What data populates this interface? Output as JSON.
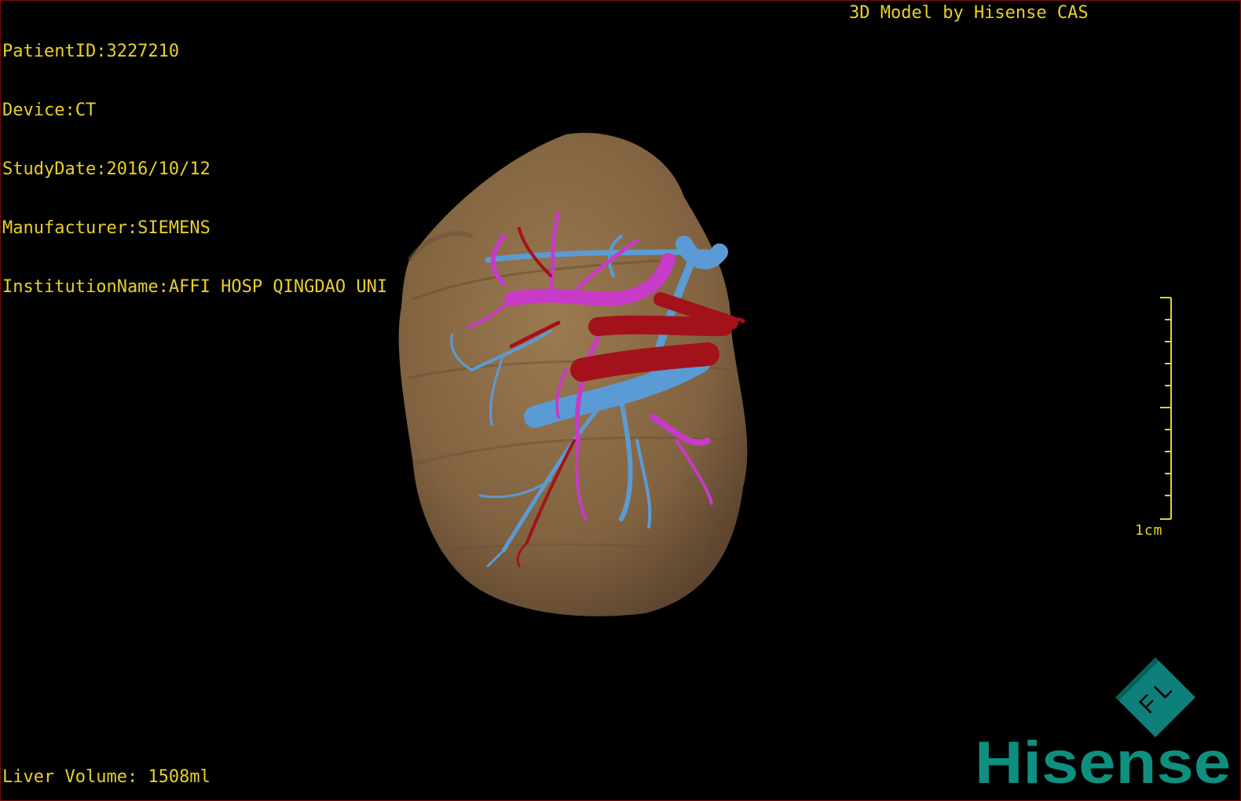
{
  "info": {
    "patient_id": "PatientID:3227210",
    "device": "Device:CT",
    "study_date": "StudyDate:2016/10/12",
    "manufacturer": "Manufacturer:SIEMENS",
    "institution": "InstitutionName:AFFI HOSP QINGDAO UNI"
  },
  "model_title": "3D Model by Hisense CAS",
  "liver_volume": "Liver Volume: 1508ml",
  "scale_bar": {
    "label": "1cm"
  },
  "orientation_marker": {
    "letters": "F L",
    "color": "#0f7f7a"
  },
  "brand": {
    "name": "Hisense",
    "color": "#0e8f80"
  },
  "colors": {
    "overlay_text": "#e8d02a",
    "liver": "#8b6b45",
    "portal_vein": "#5b9bd5",
    "hepatic_artery": "#c83ac8",
    "hepatic_vein": "#a3121a"
  }
}
